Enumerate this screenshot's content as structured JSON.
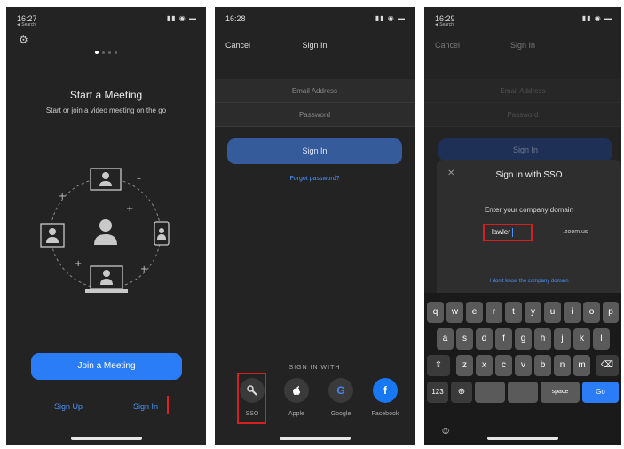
{
  "status": {
    "p1_time": "16:27",
    "p1_sub": "◀ Search",
    "p2_time": "16:28",
    "p3_time": "16:29",
    "p3_sub": "◀ Search",
    "sys_icons": "▮▮ ◉ ▬"
  },
  "panel1": {
    "gear_icon": "⚙",
    "title": "Start a Meeting",
    "subtitle": "Start or join a video meeting on the go",
    "join_button": "Join a Meeting",
    "signup_link": "Sign Up",
    "signin_link": "Sign In"
  },
  "panel2": {
    "cancel": "Cancel",
    "title": "Sign In",
    "email_placeholder": "Email Address",
    "password_placeholder": "Password",
    "signin_button": "Sign In",
    "forgot_link": "Forgot password?",
    "sign_in_with": "SIGN IN WITH",
    "providers": [
      {
        "label": "SSO",
        "glyph": "🔧"
      },
      {
        "label": "Apple",
        "glyph": ""
      },
      {
        "label": "Google",
        "glyph": "G"
      },
      {
        "label": "Facebook",
        "glyph": "f"
      }
    ],
    "colors": {
      "google": "#4285f4",
      "facebook": "#1877f2",
      "accent": "#2b7cf7",
      "highlight": "#d62020"
    }
  },
  "panel3": {
    "cancel": "Cancel",
    "title": "Sign In",
    "email_placeholder": "Email Address",
    "password_placeholder": "Password",
    "signin_button": "Sign In",
    "close_icon": "✕",
    "sheet_title": "Sign in with SSO",
    "prompt": "Enter your company domain",
    "domain_value": "lawler",
    "domain_suffix": ".zoom.us",
    "dont_know_link": "I don't know the company domain",
    "keyboard": {
      "row1": [
        "q",
        "w",
        "e",
        "r",
        "t",
        "y",
        "u",
        "i",
        "o",
        "p"
      ],
      "row2": [
        "a",
        "s",
        "d",
        "f",
        "g",
        "h",
        "j",
        "k",
        "l"
      ],
      "row3": [
        "z",
        "x",
        "c",
        "v",
        "b",
        "n",
        "m"
      ],
      "shift": "⇧",
      "backspace": "⌫",
      "numbers": "123",
      "globe": "⊕",
      "space": "space",
      "go": "Go",
      "emoji": "☺"
    }
  }
}
